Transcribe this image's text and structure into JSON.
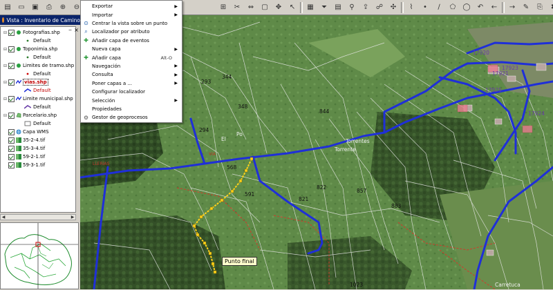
{
  "colors": {
    "selected_text": "#c00000",
    "title_bar": "#0a246a",
    "road_blue": "#1f2fd8",
    "route_yellow": "#ffd21a",
    "panel_gray": "#d4d0c8"
  },
  "toolbar": {
    "left_icons": [
      "new-project-icon",
      "open-icon",
      "save-icon",
      "print-icon",
      "zoom-in-icon",
      "zoom-out-icon",
      "zoom-full-icon",
      "zoom-select-icon"
    ],
    "right_icons": [
      "add-layer-icon",
      "measure-icon",
      "link-icon",
      "select-rect-icon",
      "pan-icon",
      "select-icon",
      "table-icon",
      "filter-icon",
      "table-open-icon",
      "query-icon",
      "export-icon",
      "hyperlink-icon",
      "move-icon",
      "graph-icon",
      "point-icon",
      "line-icon",
      "polygon-icon",
      "circle-icon",
      "undo-icon",
      "back-icon",
      "forward-icon",
      "edit-icon",
      "copy-icon",
      "delete-icon",
      "cut-icon",
      "pointer-icon",
      "info-icon",
      "grid-icon"
    ]
  },
  "view": {
    "title": "Vista : Inventario de Camino"
  },
  "toc": {
    "layers": [
      {
        "name": "Fotografias.shp",
        "legend": "Default",
        "icon": "point-layer-icon"
      },
      {
        "name": "Toponimia.shp",
        "legend": "Default",
        "icon": "point-layer-icon"
      },
      {
        "name": "Limites de tramo.shp",
        "legend": "Default",
        "icon": "point-layer-icon"
      },
      {
        "name": "vias.shp",
        "legend": "Default",
        "icon": "line-layer-icon"
      },
      {
        "name": "Limite municipal.shp",
        "legend": "Default",
        "icon": "line-layer-icon"
      },
      {
        "name": "Parcelario.shp",
        "legend": "Default",
        "icon": "polygon-layer-icon"
      },
      {
        "name": "Capa WMS",
        "legend": "",
        "icon": "wms-layer-icon"
      },
      {
        "name": "35-2-4.tif",
        "legend": "",
        "icon": "raster-layer-icon"
      },
      {
        "name": "35-3-4.tif",
        "legend": "",
        "icon": "raster-layer-icon"
      },
      {
        "name": "59-2-1.tif",
        "legend": "",
        "icon": "raster-layer-icon"
      },
      {
        "name": "59-3-1.tif",
        "legend": "",
        "icon": "raster-layer-icon"
      }
    ]
  },
  "context_menu": {
    "items": [
      {
        "label": "Exportar",
        "submenu": true,
        "shortcut": "",
        "icon": ""
      },
      {
        "label": "Importar",
        "submenu": true,
        "shortcut": "",
        "icon": ""
      },
      {
        "label": "Centrar la vista sobre un punto",
        "submenu": false,
        "shortcut": "",
        "icon": "center-icon"
      },
      {
        "label": "Localizador por atributo",
        "submenu": false,
        "shortcut": "",
        "icon": "locator-icon"
      },
      {
        "label": "Añadir capa de eventos",
        "submenu": false,
        "shortcut": "",
        "icon": "event-layer-icon"
      },
      {
        "label": "Nueva capa",
        "submenu": true,
        "shortcut": "",
        "icon": ""
      },
      {
        "label": "Añadir capa",
        "submenu": false,
        "shortcut": "Alt-O",
        "icon": "add-layer-icon"
      },
      {
        "label": "Navegación",
        "submenu": true,
        "shortcut": "",
        "icon": ""
      },
      {
        "label": "Consulta",
        "submenu": true,
        "shortcut": "",
        "icon": ""
      },
      {
        "label": "Poner capas a ...",
        "submenu": true,
        "shortcut": "",
        "icon": ""
      },
      {
        "label": "Configurar localizador",
        "submenu": false,
        "shortcut": "",
        "icon": ""
      },
      {
        "label": "Selección",
        "submenu": true,
        "shortcut": "",
        "icon": ""
      },
      {
        "label": "Propiedades",
        "submenu": false,
        "shortcut": "",
        "icon": ""
      },
      {
        "label": "Gestor de geoprocesos",
        "submenu": false,
        "shortcut": "",
        "icon": "geoprocess-icon"
      }
    ]
  },
  "map": {
    "callout": "Punto final",
    "labels": [
      {
        "text": "344",
        "kind": "parcel"
      },
      {
        "text": "348",
        "kind": "parcel"
      },
      {
        "text": "293",
        "kind": "parcel"
      },
      {
        "text": "294",
        "kind": "parcel"
      },
      {
        "text": "El",
        "kind": "white"
      },
      {
        "text": "Po",
        "kind": "white"
      },
      {
        "text": "Torrentes",
        "kind": "white"
      },
      {
        "text": "Torrente",
        "kind": "white"
      },
      {
        "text": "568",
        "kind": "parcel"
      },
      {
        "text": "591",
        "kind": "parcel"
      },
      {
        "text": "821",
        "kind": "parcel"
      },
      {
        "text": "822",
        "kind": "parcel"
      },
      {
        "text": "844",
        "kind": "parcel"
      },
      {
        "text": "857",
        "kind": "parcel"
      },
      {
        "text": "883",
        "kind": "parcel"
      },
      {
        "text": "1023",
        "kind": "parcel"
      },
      {
        "text": "17920",
        "kind": "road"
      },
      {
        "text": "17921",
        "kind": "road"
      },
      {
        "text": "17923",
        "kind": "road"
      },
      {
        "text": "17924",
        "kind": "road"
      },
      {
        "text": "17925",
        "kind": "road"
      },
      {
        "text": "Carretuca",
        "kind": "white"
      },
      {
        "text": "LLERIAS",
        "kind": "red"
      },
      {
        "text": "VIA",
        "kind": "red"
      }
    ]
  }
}
